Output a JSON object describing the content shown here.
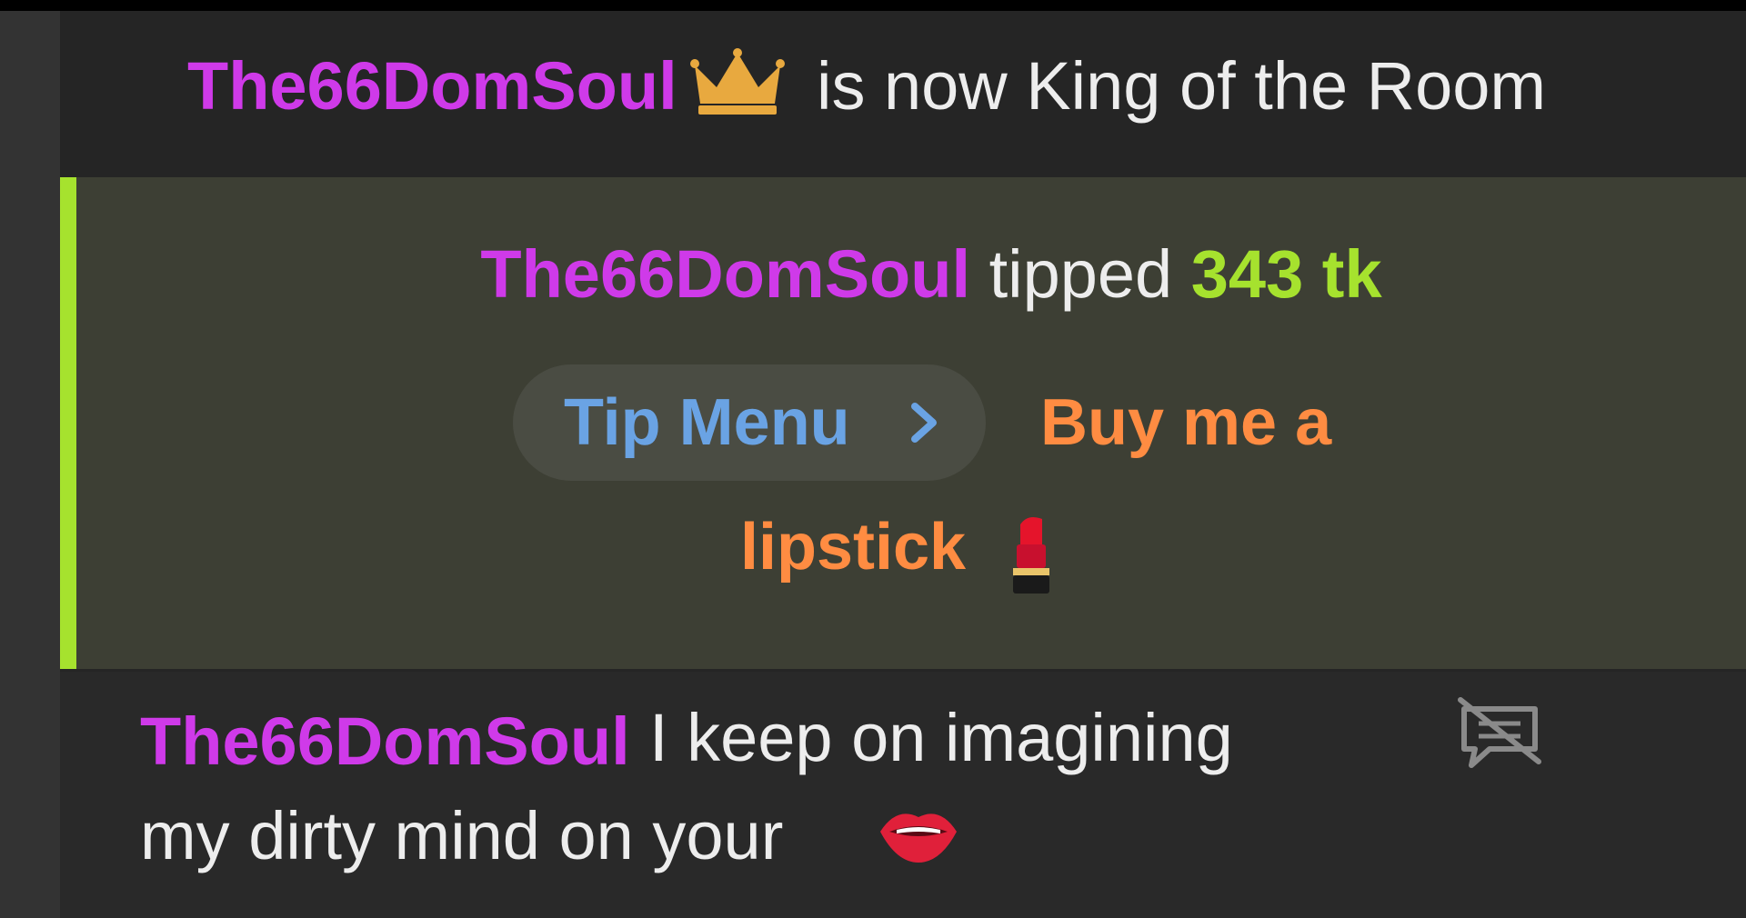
{
  "king_notice": {
    "username": "The66DomSoul",
    "icon": "crown-icon",
    "text": "is now King of the Room"
  },
  "tip": {
    "username": "The66DomSoul",
    "verb": "tipped",
    "amount": "343 tk",
    "menu_label": "Tip Menu",
    "item_line1": "Buy me a",
    "item_line2": "lipstick",
    "item_icon": "lipstick-icon"
  },
  "message": {
    "username": "The66DomSoul",
    "line1": "I keep on imagining",
    "line2": "my dirty mind on your",
    "emoji_icon": "lips-icon",
    "action_icon": "hide-chat-icon"
  },
  "colors": {
    "username": "#cf3ae9",
    "tip_amount": "#a6e22e",
    "tip_menu": "#6aa3e4",
    "tip_item": "#ff8c42",
    "tip_background": "#3d3f34",
    "chat_background": "#252525"
  }
}
